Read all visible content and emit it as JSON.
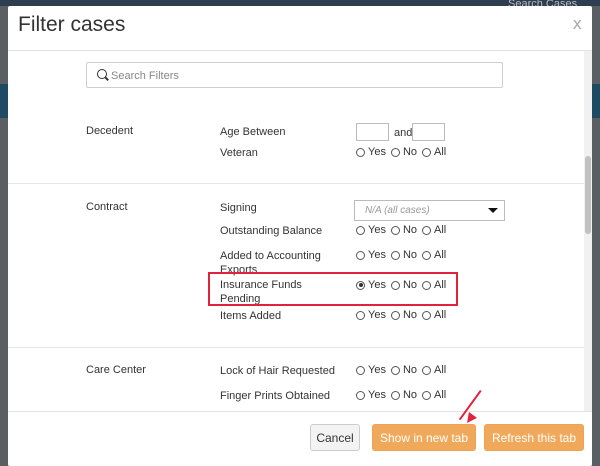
{
  "backdrop": {
    "search_text": "Search Cases"
  },
  "modal": {
    "title": "Filter cases",
    "close_label": "x",
    "search": {
      "placeholder": "Search Filters",
      "value": ""
    }
  },
  "sections": {
    "decedent": {
      "label": "Decedent",
      "age_label": "Age Between",
      "age_and": "and",
      "veteran_label": "Veteran"
    },
    "contract": {
      "label": "Contract",
      "signing_label": "Signing",
      "signing_value": "N/A (all cases)",
      "outstanding_label": "Outstanding Balance",
      "accounting_label": "Added to Accounting Exports",
      "insurance_label": "Insurance Funds Pending",
      "items_label": "Items Added"
    },
    "care_center": {
      "label": "Care Center",
      "hair_label": "Lock of Hair Requested",
      "prints_label": "Finger Prints Obtained"
    }
  },
  "radio": {
    "yes": "Yes",
    "no": "No",
    "all": "All"
  },
  "radio_selected": {
    "veteran": "all",
    "outstanding": "all",
    "accounting": "all",
    "insurance": "yes",
    "items": "all",
    "hair": "all",
    "prints": "all"
  },
  "footer": {
    "cancel_label": "Cancel",
    "show_new_tab_label": "Show in new tab",
    "refresh_label": "Refresh this tab"
  },
  "colors": {
    "accent": "#f0a95a",
    "highlight": "#e0233a"
  }
}
